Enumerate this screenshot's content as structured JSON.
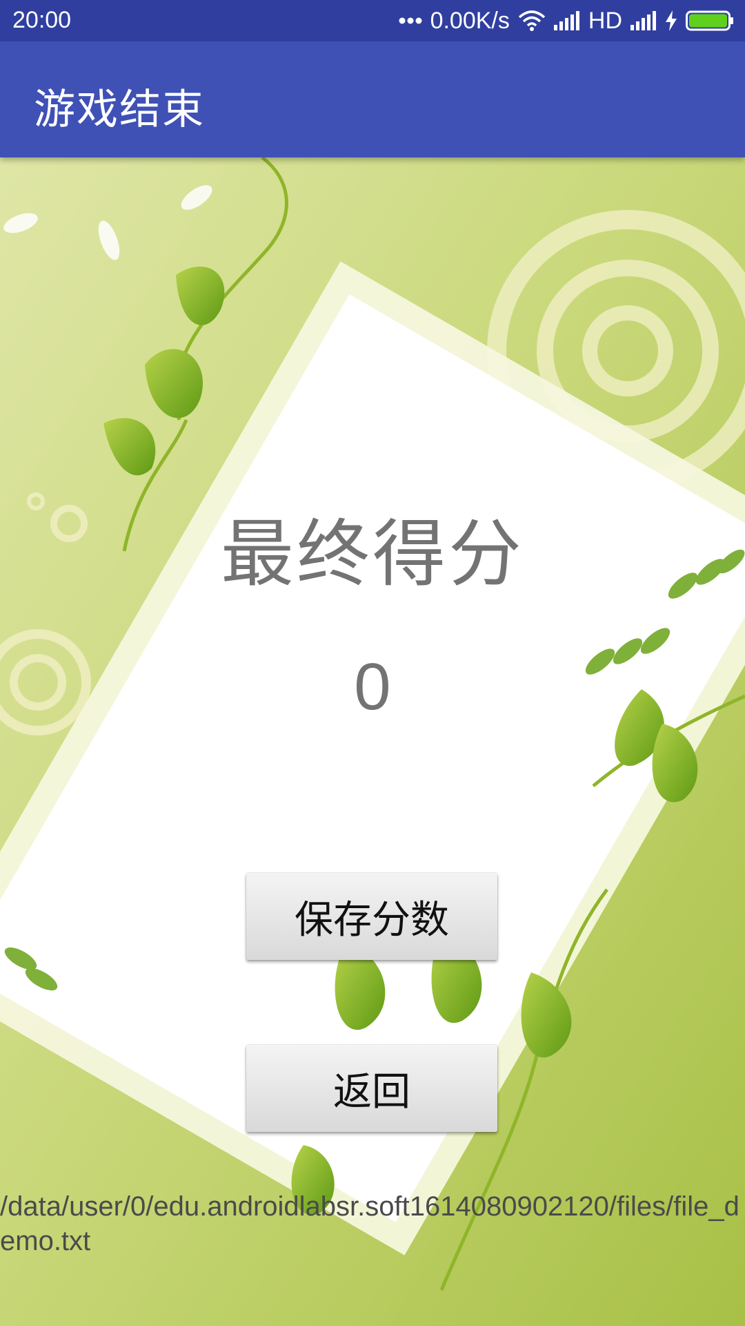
{
  "status_bar": {
    "time": "20:00",
    "network_speed": "0.00K/s",
    "hd_label": "HD",
    "icons": [
      "more-dots-icon",
      "wifi-icon",
      "signal-icon",
      "signal-icon",
      "charging-icon",
      "battery-icon"
    ]
  },
  "app_bar": {
    "title": "游戏结束"
  },
  "main": {
    "score_label": "最终得分",
    "score_value": "0",
    "save_button_label": "保存分数",
    "back_button_label": "返回",
    "file_path": "/data/user/0/edu.androidlabsr.soft1614080902120/files/file_demo.txt"
  },
  "colors": {
    "status_bar": "#303f9f",
    "app_bar": "#3f51b5",
    "text_gray": "#737373"
  }
}
